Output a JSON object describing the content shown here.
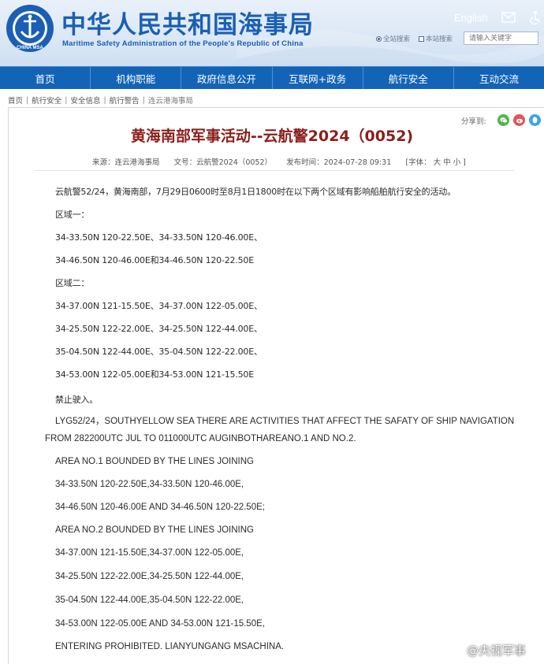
{
  "header": {
    "title_cn": "中华人民共和国海事局",
    "title_en": "Maritime Safety Administration of the People's Republic of China",
    "logo_text": "CHINA MSA",
    "lang_link": "English",
    "search": {
      "opt1": "全站搜索",
      "opt2": "本站搜索",
      "placeholder": "请输入关键字"
    }
  },
  "nav": {
    "items": [
      "首页",
      "机构职能",
      "政府信息公开",
      "互联网+政务",
      "航行安全",
      "互动交流"
    ]
  },
  "breadcrumb": [
    "首页",
    "航行安全",
    "安全信息",
    "航行警告",
    "连云港海事局"
  ],
  "share": {
    "label": "分享到:",
    "icons": [
      "wechat-icon",
      "weibo-icon",
      "qq-icon"
    ],
    "colors": [
      "#4cb849",
      "#e05656",
      "#3aa3e5"
    ]
  },
  "article": {
    "title": "黄海南部军事活动--云航警2024（0052)",
    "meta": {
      "source": "来源：连云港海事局",
      "doc_no": "文号：云航警2024（0052）",
      "time": "发布时间：2024-07-28 09:31",
      "font": "[字体： 大  中  小 ]"
    },
    "cn_lines": [
      "云航警52/24，黄海南部，7月29日0600时至8月1日1800时在以下两个区域有影响船舶航行安全的活动。",
      "区域一：",
      "34-33.50N 120-22.50E、34-33.50N 120-46.00E、",
      "34-46.50N 120-46.00E和34-46.50N 120-22.50E",
      "区域二：",
      "34-37.00N 121-15.50E、34-37.00N 122-05.00E、",
      "34-25.50N 122-22.00E、34-25.50N 122-44.00E、",
      "35-04.50N 122-44.00E、35-04.50N 122-22.00E、",
      "34-53.00N 122-05.00E和34-53.00N 121-15.50E",
      "禁止驶入。"
    ],
    "en_paragraph": "LYG52/24，SOUTHYELLOW SEA THERE ARE ACTIVITIES THAT AFFECT THE SAFATY OF SHIP NAVIGATION FROM 282200UTC JUL TO 011000UTC AUGINBOTHAREANO.1 AND NO.2.",
    "en_lines": [
      "AREA NO.1 BOUNDED BY THE LINES JOINING",
      "34-33.50N 120-22.50E,34-33.50N 120-46.00E,",
      "34-46.50N 120-46.00E AND 34-46.50N 120-22.50E;",
      "AREA NO.2 BOUNDED BY THE LINES JOINING",
      "34-37.00N 121-15.50E,34-37.00N 122-05.00E,",
      "34-25.50N 122-22.00E,34-25.50N 122-44.00E,",
      "35-04.50N 122-44.00E,35-04.50N 122-22.00E,",
      "34-53.00N 122-05.00E AND 34-53.00N 121-15.50E,",
      "ENTERING PROHIBITED. LIANYUNGANG MSACHINA."
    ]
  },
  "watermark": "@央视军事",
  "colors": {
    "nav_bg": "#1364b7",
    "title_blue": "#1a5fb4",
    "article_title": "#8a1f1a"
  }
}
